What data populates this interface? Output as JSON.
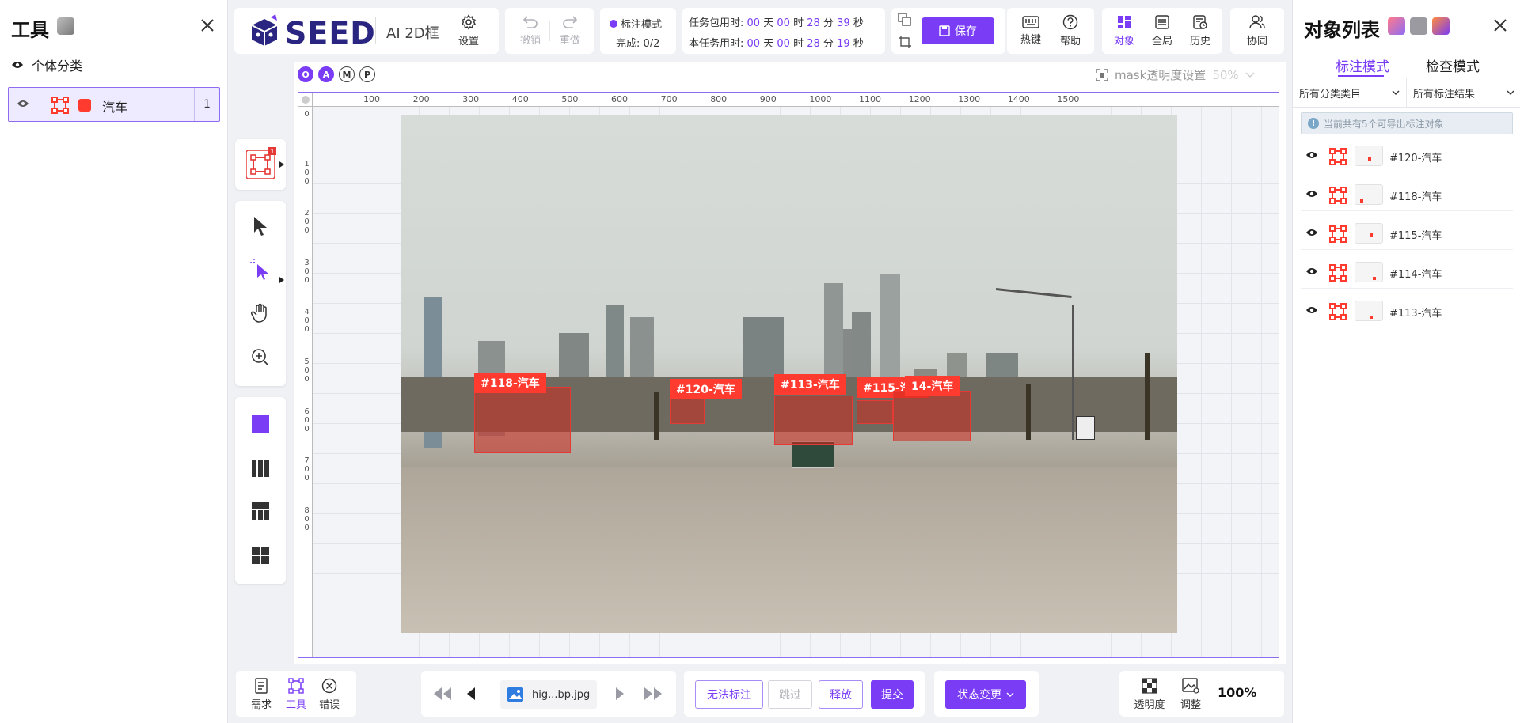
{
  "left_panel": {
    "title": "工具",
    "classify_label": "个体分类",
    "class_item": {
      "name": "汽车",
      "count": "1",
      "color": "#ff3b30"
    }
  },
  "toolbar": {
    "logo_text": "SEED",
    "app_subtitle": "AI 2D框",
    "settings_label": "设置",
    "undo_label": "撤销",
    "redo_label": "重做",
    "mode_label": "标注模式",
    "progress_text": "完成: 0/2",
    "task_total_label": "任务包用时:",
    "task_total": {
      "days": "00",
      "hours": "00",
      "minutes": "28",
      "seconds": "39"
    },
    "task_this_label": "本任务用时:",
    "task_this": {
      "days": "00",
      "hours": "00",
      "minutes": "28",
      "seconds": "19"
    },
    "unit_day": "天",
    "unit_hour": "时",
    "unit_min": "分",
    "unit_sec": "秒",
    "save_label": "保存",
    "hotkey_label": "热键",
    "help_label": "帮助",
    "view_object_label": "对象",
    "view_global_label": "全局",
    "view_history_label": "历史",
    "collab_label": "协同"
  },
  "canvas": {
    "overlay_modes": [
      "O",
      "A",
      "M",
      "P"
    ],
    "mask_setting_label": "mask透明度设置",
    "mask_value": "50%",
    "ruler_top": [
      "100",
      "200",
      "300",
      "400",
      "500",
      "600",
      "700",
      "800",
      "900",
      "1000",
      "1100",
      "1200",
      "1300",
      "1400",
      "1500"
    ],
    "ruler_left": [
      "0",
      "100",
      "200",
      "300",
      "400",
      "500",
      "600",
      "700",
      "800"
    ],
    "annotations": [
      {
        "label": "#118-汽车"
      },
      {
        "label": "#120-汽车"
      },
      {
        "label": "#113-汽车"
      },
      {
        "label": "#115-汽车"
      },
      {
        "label": "14-汽车"
      }
    ],
    "tool_badge": "1"
  },
  "bottom_bar": {
    "requirements_label": "需求",
    "tools_label": "工具",
    "errors_label": "错误",
    "filename": "hig...bp.jpg",
    "cannot_label_btn": "无法标注",
    "skip_btn": "跳过",
    "release_btn": "释放",
    "submit_btn": "提交",
    "status_change_btn": "状态变更",
    "opacity_label": "透明度",
    "adjust_label": "调整",
    "zoom": "100%"
  },
  "right_panel": {
    "title": "对象列表",
    "tab_label_mode": "标注模式",
    "tab_check_mode": "检查模式",
    "filter_category": "所有分类类目",
    "filter_result": "所有标注结果",
    "notice": "当前共有5个可导出标注对象",
    "objects": [
      {
        "name": "#120-汽车"
      },
      {
        "name": "#118-汽车"
      },
      {
        "name": "#115-汽车"
      },
      {
        "name": "#114-汽车"
      },
      {
        "name": "#113-汽车"
      }
    ]
  },
  "colors": {
    "accent": "#7a3cf5",
    "annotation": "#ff3b30"
  }
}
